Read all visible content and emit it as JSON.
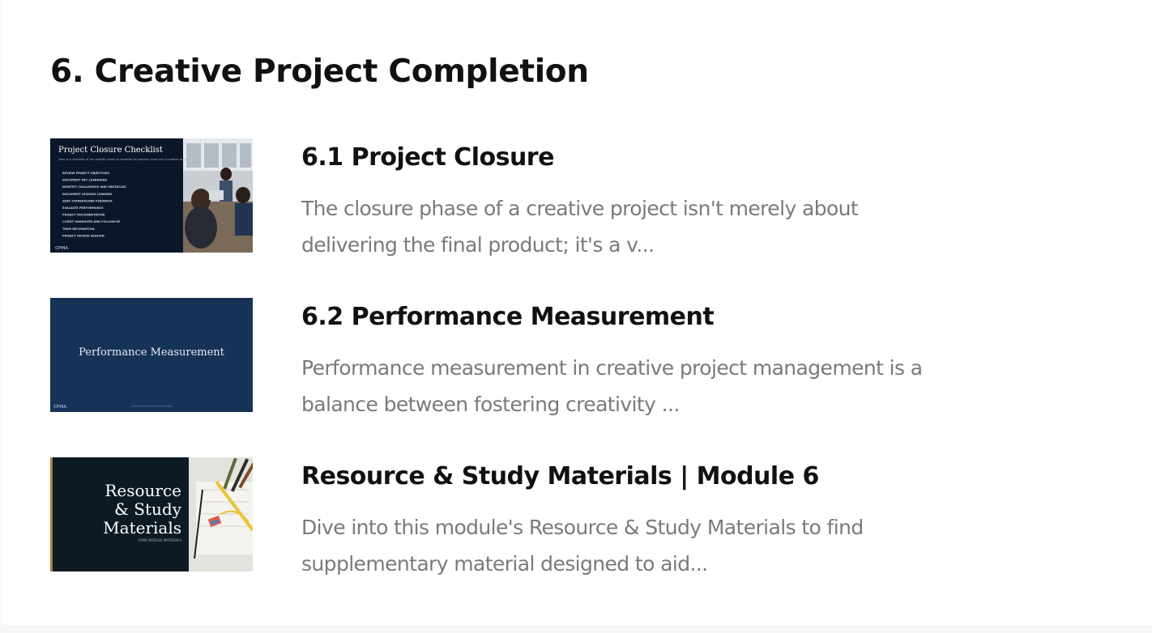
{
  "section": {
    "title": "6. Creative Project Completion"
  },
  "lessons": [
    {
      "title": "6.1 Project Closure",
      "description": "The closure phase of a creative project isn't merely about delivering the final product; it's a v...",
      "thumbnail": {
        "heading": "Project Closure Checklist",
        "intro": "Here is a checklist of ten specific areas to consider to properly close out a creative project:",
        "bullets": [
          "REVIEW PROJECT OBJECTIVES",
          "DOCUMENT KEY LEARNINGS",
          "IDENTIFY CHALLENGES AND OBSTACLES",
          "DOCUMENT LESSONS LEARNED",
          "SEEK STAKEHOLDER FEEDBACK",
          "EVALUATE PERFORMANCE",
          "PROJECT DOCUMENTATION",
          "CLIENT HANDOVER AND FOLLOW-UP",
          "TEAM RECOGNITION",
          "PROJECT REVIEW SESSION"
        ],
        "logo": "CPMA"
      }
    },
    {
      "title": "6.2 Performance Measurement",
      "description": "Performance measurement in creative project management is a balance between fostering creativity ...",
      "thumbnail": {
        "heading": "Performance Measurement",
        "logo": "CPMA"
      }
    },
    {
      "title": "Resource & Study Materials | Module 6",
      "description": "Dive into this module's Resource & Study Materials to find supplementary material designed to aid...",
      "thumbnail": {
        "heading_line1": "Resource",
        "heading_line2": "& Study",
        "heading_line3": "Materials",
        "caption": "CPMA MODULE MATERIALS"
      }
    }
  ],
  "colors": {
    "title": "#111111",
    "description": "#7a7a7a",
    "thumb_navy": "#0b1628",
    "thumb_blue": "#163256",
    "thumb_dark": "#0d1a24"
  }
}
